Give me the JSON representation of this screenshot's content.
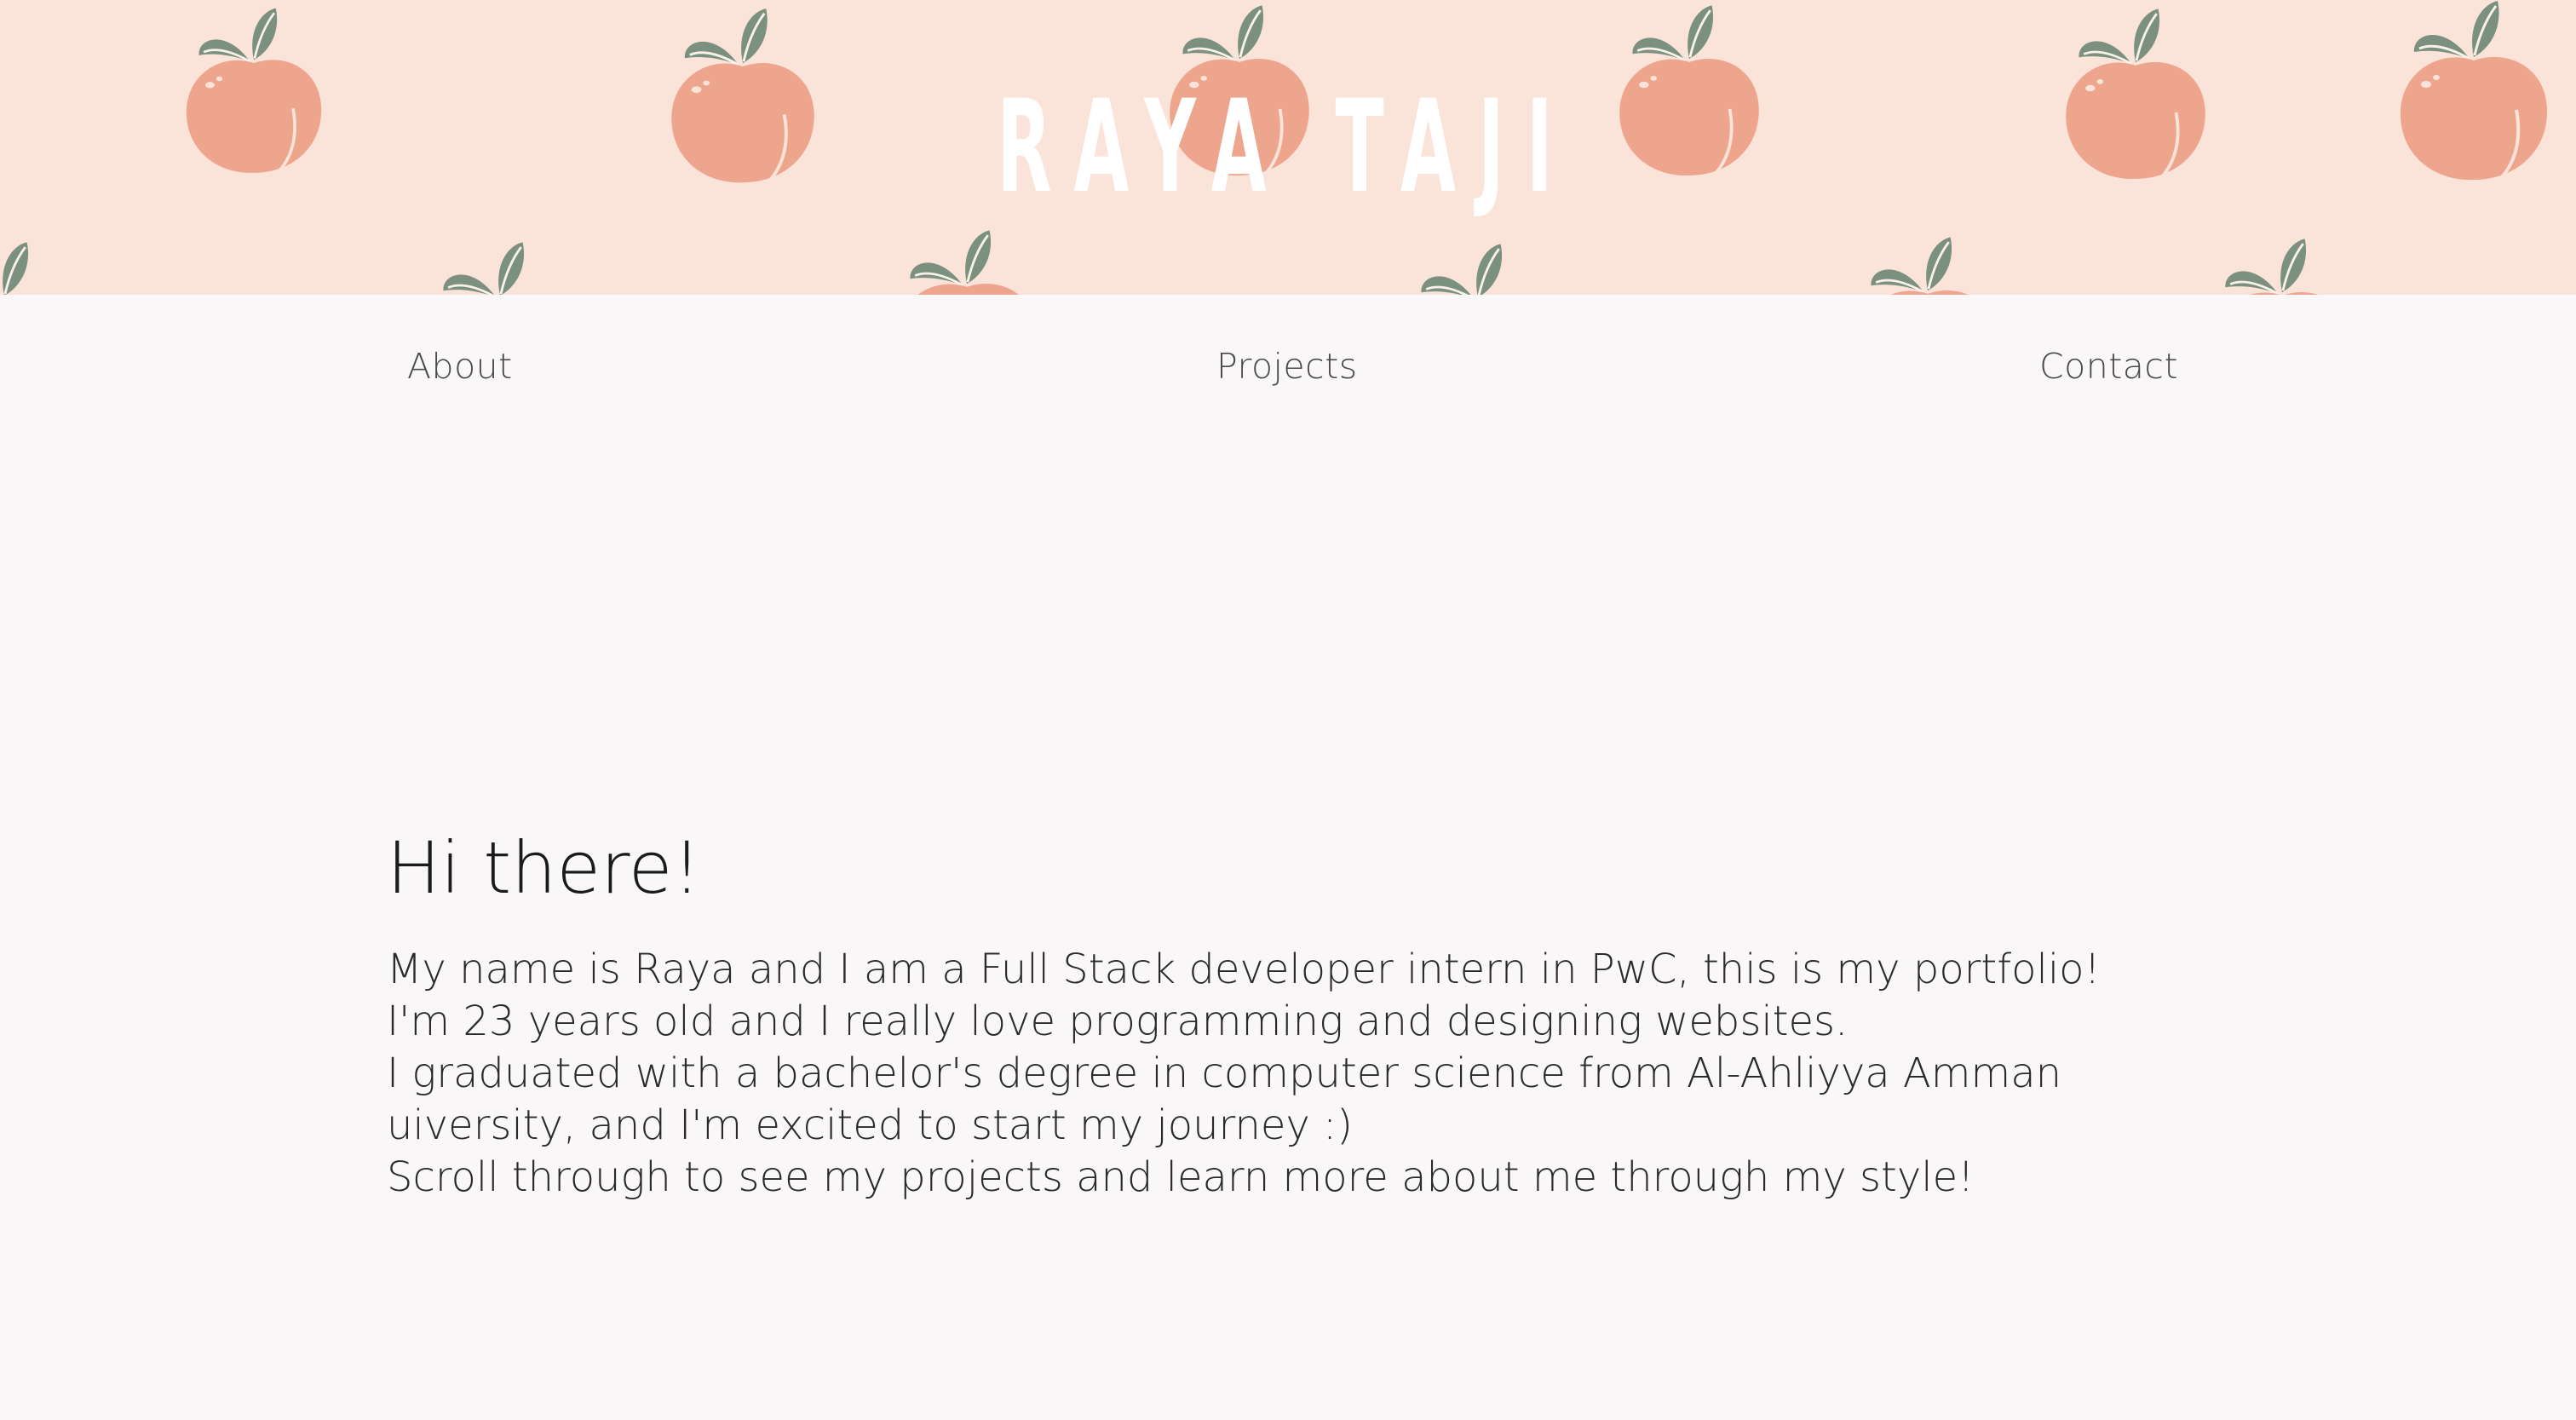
{
  "header": {
    "title": "RAYA TAJI",
    "background_color": "#fae3d8",
    "pattern_icon": "peach-icon"
  },
  "nav": {
    "items": [
      {
        "label": "About"
      },
      {
        "label": "Projects"
      },
      {
        "label": "Contact"
      }
    ]
  },
  "intro": {
    "heading": "Hi there!",
    "lines": [
      "My name is Raya and I am a Full Stack developer intern in PwC, this is my portfolio!",
      "I'm 23 years old and I really love programming and designing websites.",
      "I graduated with a bachelor's degree in computer science from Al-Ahliyya Amman",
      "uiversity, and I'm excited to start my journey :)",
      "Scroll through to see my projects and learn more about me through my style!"
    ]
  },
  "colors": {
    "peach": "#eea58e",
    "leaf": "#7b907f",
    "page_background": "#f9f7f8"
  }
}
